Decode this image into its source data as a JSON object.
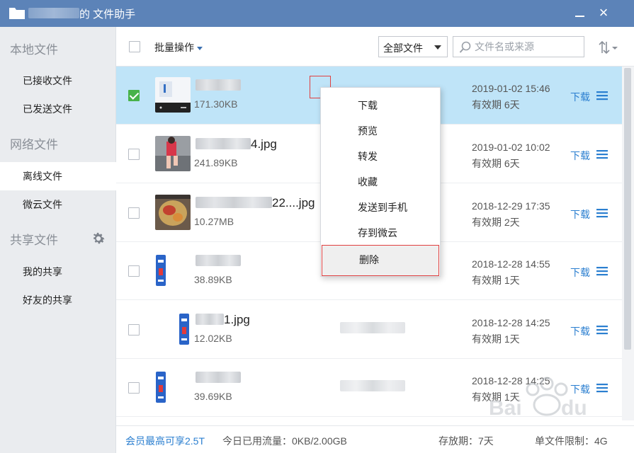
{
  "titlebar": {
    "title": "的 文件助手",
    "icon": "folder-icon"
  },
  "sidebar": {
    "sections": [
      {
        "label": "本地文件"
      },
      {
        "label": "网络文件"
      },
      {
        "label": "共享文件"
      }
    ],
    "items": [
      {
        "label": "已接收文件"
      },
      {
        "label": "已发送文件"
      },
      {
        "label": "离线文件",
        "active": true
      },
      {
        "label": "微云文件"
      },
      {
        "label": "我的共享"
      },
      {
        "label": "好友的共享"
      }
    ]
  },
  "toolbar": {
    "batch_label": "批量操作",
    "filter_value": "全部文件",
    "search_placeholder": "文件名或来源"
  },
  "files": [
    {
      "name_suffix": "",
      "size": "171.30KB",
      "date": "2019-01-02 15:46",
      "expiry": "有效期 6天",
      "download": "下载",
      "selected": true
    },
    {
      "name_suffix": "4.jpg",
      "size": "241.89KB",
      "date": "2019-01-02 10:02",
      "expiry": "有效期 6天",
      "download": "下载"
    },
    {
      "name_suffix": "22....jpg",
      "size": "10.27MB",
      "date": "2018-12-29 17:35",
      "expiry": "有效期 2天",
      "download": "下载"
    },
    {
      "name_suffix": "",
      "size": "38.89KB",
      "date": "2018-12-28 14:55",
      "expiry": "有效期 1天",
      "download": "下载"
    },
    {
      "name_suffix": "1.jpg",
      "size": "12.02KB",
      "date": "2018-12-28 14:25",
      "expiry": "有效期 1天",
      "download": "下载"
    },
    {
      "name_suffix": "",
      "size": "39.69KB",
      "date": "2018-12-28 14:25",
      "expiry": "有效期 1天",
      "download": "下载"
    }
  ],
  "context_menu": {
    "items": [
      {
        "label": "下载"
      },
      {
        "label": "预览"
      },
      {
        "label": "转发"
      },
      {
        "label": "收藏"
      },
      {
        "label": "发送到手机"
      },
      {
        "label": "存到微云"
      },
      {
        "label": "删除",
        "highlighted": true
      }
    ]
  },
  "footer": {
    "vip": "会员最高可享2.5T",
    "flow": "今日已用流量：0KB/2.00GB",
    "store": "存放期：7天",
    "limit": "单文件限制：4G"
  },
  "colors": {
    "titlebar": "#5c83b8",
    "selected_row": "#bfe4f8",
    "link": "#2b7fd0",
    "check": "#48b24a",
    "highlight_border": "#e04040"
  }
}
